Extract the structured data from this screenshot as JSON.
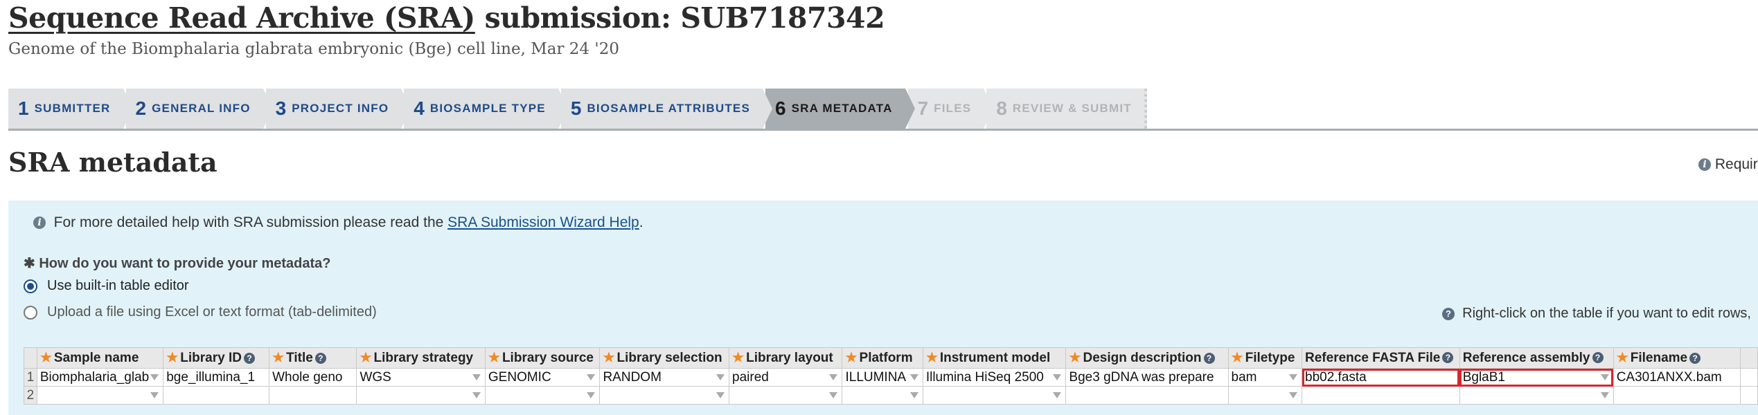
{
  "header": {
    "title_link": "Sequence Read Archive (SRA)",
    "title_rest": " submission: SUB7187342",
    "subtitle": "Genome of the Biomphalaria glabrata embryonic (Bge) cell line, Mar 24 '20"
  },
  "steps": [
    {
      "num": "1",
      "label": "SUBMITTER",
      "state": "done"
    },
    {
      "num": "2",
      "label": "GENERAL INFO",
      "state": "done"
    },
    {
      "num": "3",
      "label": "PROJECT INFO",
      "state": "done"
    },
    {
      "num": "4",
      "label": "BIOSAMPLE TYPE",
      "state": "done"
    },
    {
      "num": "5",
      "label": "BIOSAMPLE ATTRIBUTES",
      "state": "done"
    },
    {
      "num": "6",
      "label": "SRA METADATA",
      "state": "active"
    },
    {
      "num": "7",
      "label": "FILES",
      "state": "disabled"
    },
    {
      "num": "8",
      "label": "REVIEW & SUBMIT",
      "state": "disabled"
    }
  ],
  "section": {
    "title": "SRA metadata",
    "required_note": "Require"
  },
  "help": {
    "prefix": "For more detailed help with SRA submission please read the ",
    "link": "SRA Submission Wizard Help",
    "suffix": "."
  },
  "metadata_question": {
    "label": "How do you want to provide your metadata?",
    "options": [
      {
        "label": "Use built-in table editor",
        "selected": true
      },
      {
        "label": "Upload a file using Excel or text format (tab-delimited)",
        "selected": false
      }
    ]
  },
  "right_click_hint": "Right-click on the table if you want to edit rows,",
  "grid": {
    "columns": [
      {
        "label": "Sample name",
        "required": true,
        "help": false
      },
      {
        "label": "Library ID",
        "required": true,
        "help": true
      },
      {
        "label": "Title",
        "required": true,
        "help": true
      },
      {
        "label": "Library strategy",
        "required": true,
        "help": false
      },
      {
        "label": "Library source",
        "required": true,
        "help": false
      },
      {
        "label": "Library selection",
        "required": true,
        "help": false
      },
      {
        "label": "Library layout",
        "required": true,
        "help": false
      },
      {
        "label": "Platform",
        "required": true,
        "help": false
      },
      {
        "label": "Instrument model",
        "required": true,
        "help": false
      },
      {
        "label": "Design description",
        "required": true,
        "help": true
      },
      {
        "label": "Filetype",
        "required": true,
        "help": false
      },
      {
        "label": "Reference FASTA File",
        "required": false,
        "help": true
      },
      {
        "label": "Reference assembly",
        "required": false,
        "help": true
      },
      {
        "label": "Filename",
        "required": true,
        "help": true
      }
    ],
    "rows": [
      {
        "num": "1",
        "cells": [
          "Biomphalaria_glab",
          "bge_illumina_1",
          "Whole geno",
          "WGS",
          "GENOMIC",
          "RANDOM",
          "paired",
          "ILLUMINA",
          "Illumina HiSeq 2500",
          "Bge3 gDNA was prepare",
          "bam",
          "bb02.fasta",
          "BglaB1",
          "CA301ANXX.bam"
        ]
      },
      {
        "num": "2",
        "cells": [
          "",
          "",
          "",
          "",
          "",
          "",
          "",
          "",
          "",
          "",
          "",
          "",
          "",
          ""
        ]
      }
    ]
  }
}
